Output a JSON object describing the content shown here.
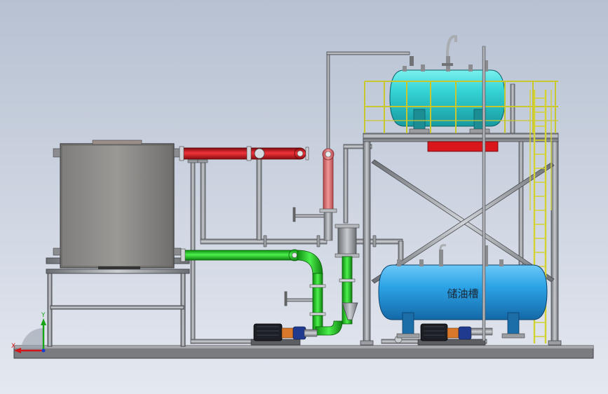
{
  "storage_tank": {
    "label": "储油槽"
  },
  "axes": {
    "x_label": "X",
    "y_label": "Y"
  },
  "colors": {
    "background_top": "#b9c3d3",
    "background_bottom": "#e3e8f0",
    "hot_pipe": "#d4141a",
    "return_pipe": "#1ecb1e",
    "expansion_tank": "#34d6d8",
    "storage_tank": "#2aa3e6",
    "ladder": "#d8d83a",
    "pump_motor": "#1a1e24",
    "steel": "#8c8f94"
  }
}
